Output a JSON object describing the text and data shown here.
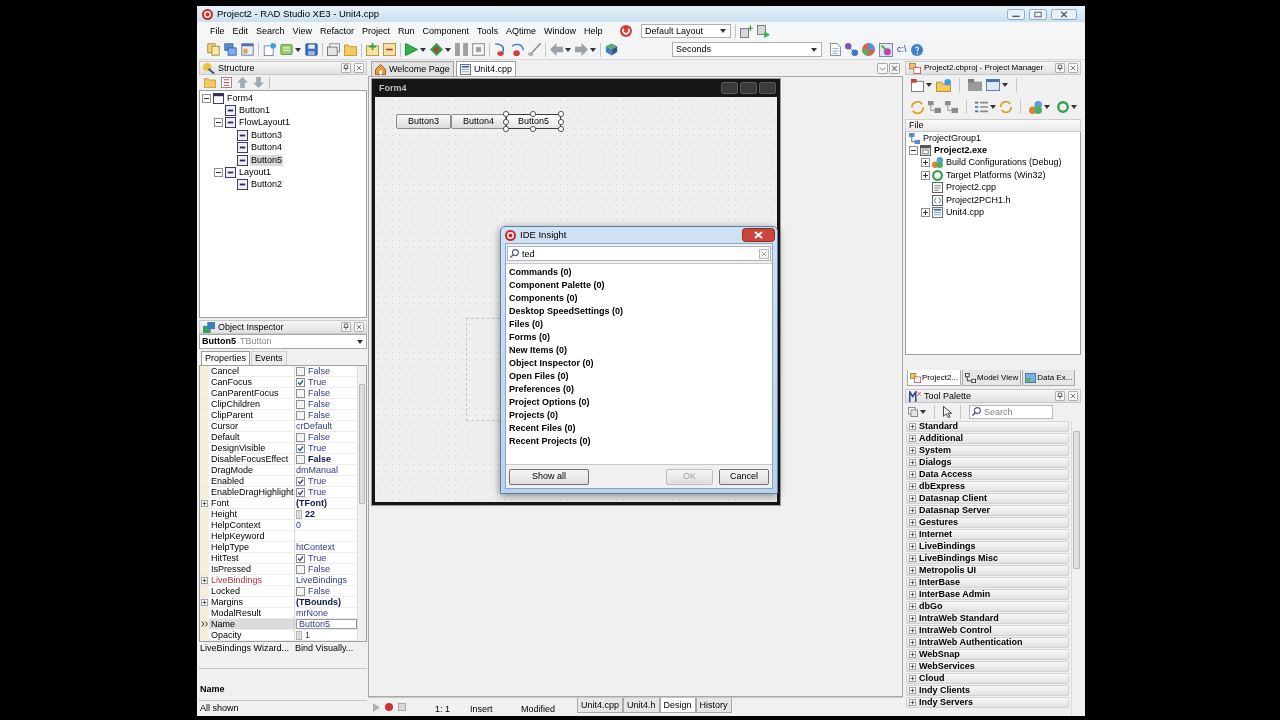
{
  "window": {
    "title": "Project2 - RAD Studio XE3 - Unit4.cpp"
  },
  "menu": [
    "File",
    "Edit",
    "Search",
    "View",
    "Refactor",
    "Project",
    "Run",
    "Component",
    "Tools",
    "AQtime",
    "Window",
    "Help"
  ],
  "layout_combo": {
    "value": "Default Layout"
  },
  "toolbar": {
    "combo_value": "Seconds",
    "path_label": "c:\\"
  },
  "structure": {
    "title": "Structure",
    "tree": [
      {
        "label": "Form4",
        "expanded": true,
        "selected": false,
        "children": [
          {
            "label": "Button1",
            "selected": false
          },
          {
            "label": "FlowLayout1",
            "expanded": true,
            "selected": false,
            "children": [
              {
                "label": "Button3",
                "selected": false
              },
              {
                "label": "Button4",
                "selected": false
              },
              {
                "label": "Button5",
                "selected": true
              }
            ]
          },
          {
            "label": "Layout1",
            "expanded": true,
            "selected": false,
            "children": [
              {
                "label": "Button2",
                "selected": false
              }
            ]
          }
        ]
      }
    ]
  },
  "object_inspector": {
    "title": "Object Inspector",
    "object_name": "Button5",
    "object_type": "TButton",
    "tabs": [
      {
        "label": "Properties",
        "selected": true
      },
      {
        "label": "Events",
        "selected": false
      }
    ],
    "properties": [
      {
        "name": "Cancel",
        "kind": "check",
        "value": "False",
        "checked": false,
        "bold": false,
        "expandable": false,
        "highlighted": false,
        "selected": false
      },
      {
        "name": "CanFocus",
        "kind": "check",
        "value": "True",
        "checked": true,
        "bold": false,
        "expandable": false,
        "highlighted": false,
        "selected": false
      },
      {
        "name": "CanParentFocus",
        "kind": "check",
        "value": "False",
        "checked": false,
        "bold": false,
        "expandable": false,
        "highlighted": false,
        "selected": false
      },
      {
        "name": "ClipChildren",
        "kind": "check",
        "value": "False",
        "checked": false,
        "bold": false,
        "expandable": false,
        "highlighted": false,
        "selected": false
      },
      {
        "name": "ClipParent",
        "kind": "check",
        "value": "False",
        "checked": false,
        "bold": false,
        "expandable": false,
        "highlighted": false,
        "selected": false
      },
      {
        "name": "Cursor",
        "kind": "text",
        "value": "crDefault",
        "bold": false,
        "expandable": false,
        "highlighted": false,
        "selected": false
      },
      {
        "name": "Default",
        "kind": "check",
        "value": "False",
        "checked": false,
        "bold": false,
        "expandable": false,
        "highlighted": false,
        "selected": false
      },
      {
        "name": "DesignVisible",
        "kind": "check",
        "value": "True",
        "checked": true,
        "bold": false,
        "expandable": false,
        "highlighted": false,
        "selected": false
      },
      {
        "name": "DisableFocusEffect",
        "kind": "check",
        "value": "False",
        "checked": false,
        "bold": true,
        "expandable": false,
        "highlighted": false,
        "selected": false
      },
      {
        "name": "DragMode",
        "kind": "text",
        "value": "dmManual",
        "bold": false,
        "expandable": false,
        "highlighted": false,
        "selected": false
      },
      {
        "name": "Enabled",
        "kind": "check",
        "value": "True",
        "checked": true,
        "bold": false,
        "expandable": false,
        "highlighted": false,
        "selected": false
      },
      {
        "name": "EnableDragHighlight",
        "kind": "check",
        "value": "True",
        "checked": true,
        "bold": false,
        "expandable": false,
        "highlighted": false,
        "selected": false
      },
      {
        "name": "Font",
        "kind": "text",
        "value": "(TFont)",
        "bold": true,
        "expandable": true,
        "highlighted": false,
        "selected": false
      },
      {
        "name": "Height",
        "kind": "spin",
        "value": "22",
        "bold": true,
        "expandable": false,
        "highlighted": false,
        "selected": false
      },
      {
        "name": "HelpContext",
        "kind": "text",
        "value": "0",
        "bold": false,
        "expandable": false,
        "highlighted": false,
        "selected": false
      },
      {
        "name": "HelpKeyword",
        "kind": "text",
        "expandable": false,
        "highlighted": false,
        "selected": false
      },
      {
        "name": "HelpType",
        "kind": "text",
        "value": "htContext",
        "bold": false,
        "expandable": false,
        "highlighted": false,
        "selected": false
      },
      {
        "name": "HitTest",
        "kind": "check",
        "value": "True",
        "checked": true,
        "bold": false,
        "expandable": false,
        "highlighted": false,
        "selected": false
      },
      {
        "name": "IsPressed",
        "kind": "check",
        "value": "False",
        "checked": false,
        "bold": false,
        "expandable": false,
        "highlighted": false,
        "selected": false
      },
      {
        "name": "LiveBindings",
        "kind": "text",
        "value": "LiveBindings",
        "bold": false,
        "expandable": true,
        "highlighted": true,
        "selected": false
      },
      {
        "name": "Locked",
        "kind": "check",
        "value": "False",
        "checked": false,
        "bold": false,
        "expandable": false,
        "highlighted": false,
        "selected": false
      },
      {
        "name": "Margins",
        "kind": "text",
        "value": "(TBounds)",
        "bold": true,
        "expandable": true,
        "highlighted": false,
        "selected": false
      },
      {
        "name": "ModalResult",
        "kind": "text",
        "value": "mrNone",
        "bold": false,
        "expandable": false,
        "highlighted": false,
        "selected": false
      },
      {
        "name": "Name",
        "kind": "edit",
        "value": "Button5",
        "bold": false,
        "expandable": false,
        "highlighted": false,
        "selected": true
      },
      {
        "name": "Opacity",
        "kind": "spin",
        "value": "1",
        "bold": false,
        "expandable": false,
        "highlighted": false,
        "selected": false
      }
    ],
    "links": [
      "LiveBindings Wizard...",
      "Bind Visually..."
    ],
    "description_title": "Name",
    "status": "All shown"
  },
  "editor": {
    "tabs": [
      {
        "label": "Welcome Page",
        "selected": false
      },
      {
        "label": "Unit4.cpp",
        "selected": true
      }
    ],
    "form": {
      "title": "Form4",
      "buttons": [
        {
          "label": "Button3",
          "selected": false
        },
        {
          "label": "Button4",
          "selected": false
        },
        {
          "label": "Button5",
          "selected": true
        }
      ]
    },
    "status_bar": {
      "position": "1:  1",
      "mode": "Insert",
      "state": "Modified",
      "tabs": [
        {
          "label": "Unit4.cpp",
          "selected": false
        },
        {
          "label": "Unit4.h",
          "selected": false
        },
        {
          "label": "Design",
          "selected": true
        },
        {
          "label": "History",
          "selected": false
        }
      ]
    }
  },
  "ide_insight": {
    "title": "IDE Insight",
    "query": "ted",
    "results": [
      "Commands (0)",
      "Component Palette (0)",
      "Components (0)",
      "Desktop SpeedSettings (0)",
      "Files (0)",
      "Forms (0)",
      "New Items (0)",
      "Object Inspector (0)",
      "Open Files (0)",
      "Preferences (0)",
      "Project Options (0)",
      "Projects (0)",
      "Recent Files (0)",
      "Recent Projects (0)"
    ],
    "buttons": [
      {
        "label": "Show all",
        "disabled": false
      },
      {
        "label": "OK",
        "disabled": true
      },
      {
        "label": "Cancel",
        "disabled": false
      }
    ]
  },
  "project_manager": {
    "title": "Project2.cbproj - Project Manager",
    "column": "File",
    "tree": [
      {
        "label": "ProjectGroup1",
        "bold": false,
        "children": [
          {
            "label": "Project2.exe",
            "expanded": true,
            "bold": true,
            "children": [
              {
                "label": "Build Configurations (Debug)",
                "expanded": false,
                "bold": false
              },
              {
                "label": "Target Platforms (Win32)",
                "expanded": false,
                "bold": false
              },
              {
                "label": "Project2.cpp",
                "bold": false
              },
              {
                "label": "Project2PCH1.h",
                "bold": false
              },
              {
                "label": "Unit4.cpp",
                "expanded": false,
                "bold": false
              }
            ]
          }
        ]
      }
    ]
  },
  "panel_tabs": [
    {
      "label": "Project2...",
      "selected": true
    },
    {
      "label": "Model View",
      "selected": false
    },
    {
      "label": "Data Ex...",
      "selected": false
    }
  ],
  "tool_palette": {
    "title": "Tool Palette",
    "search": {
      "placeholder": "Search"
    },
    "categories": [
      "Standard",
      "Additional",
      "System",
      "Dialogs",
      "Data Access",
      "dbExpress",
      "Datasnap Client",
      "Datasnap Server",
      "Gestures",
      "Internet",
      "LiveBindings",
      "LiveBindings Misc",
      "Metropolis UI",
      "InterBase",
      "InterBase Admin",
      "dbGo",
      "IntraWeb Standard",
      "IntraWeb Control",
      "IntraWeb Authentication",
      "WebSnap",
      "WebServices",
      "Cloud",
      "Indy Clients",
      "Indy Servers"
    ]
  }
}
